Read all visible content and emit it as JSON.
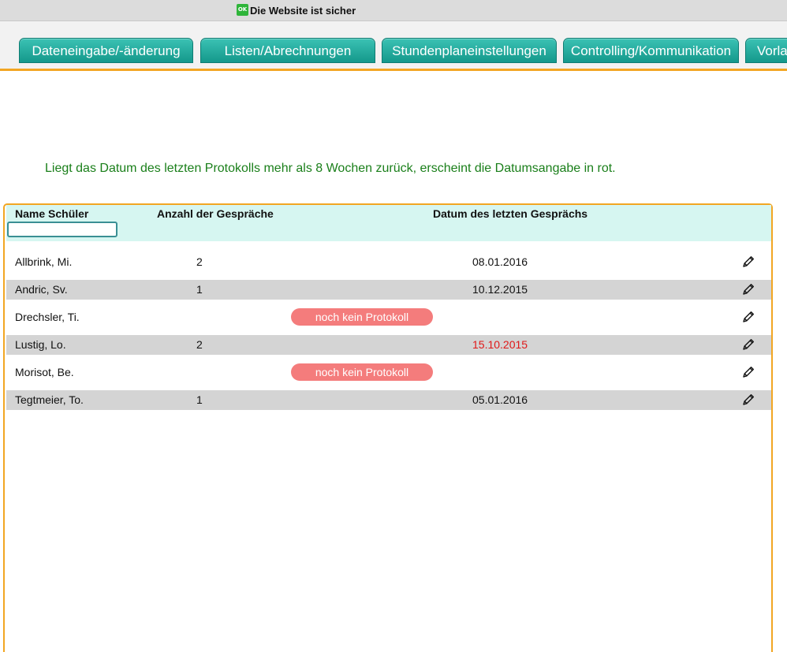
{
  "security": {
    "badge": "OK",
    "text": "Die Website ist sicher"
  },
  "tabs": [
    {
      "label": "Dateneingabe/-änderung"
    },
    {
      "label": "Listen/Abrechnungen"
    },
    {
      "label": "Stundenplaneinstellungen"
    },
    {
      "label": "Controlling/Kommunikation"
    },
    {
      "label": "Vorla"
    }
  ],
  "note": "Liegt das Datum des letzten Protokolls mehr als 8 Wochen zurück, erscheint die Datumsangabe in rot.",
  "table": {
    "headers": {
      "name": "Name Schüler",
      "count": "Anzahl der Gespräche",
      "date": "Datum des letzten Gesprächs"
    },
    "filter_value": "",
    "rows": [
      {
        "name": "Allbrink, Mi.",
        "count": "2",
        "date": "08.01.2016",
        "no_protocol": ""
      },
      {
        "name": "Andric, Sv.",
        "count": "1",
        "date": "10.12.2015",
        "no_protocol": ""
      },
      {
        "name": "Drechsler, Ti.",
        "count": "",
        "date": "",
        "no_protocol": "noch kein Protokoll"
      },
      {
        "name": "Lustig, Lo.",
        "count": "2",
        "date": "15.10.2015",
        "no_protocol": ""
      },
      {
        "name": "Morisot, Be.",
        "count": "",
        "date": "",
        "no_protocol": "noch kein Protokoll"
      },
      {
        "name": "Tegtmeier, To.",
        "count": "1",
        "date": "05.01.2016",
        "no_protocol": ""
      }
    ]
  },
  "colors": {
    "tab": "#1aa597",
    "accent_border": "#f2a623",
    "note_text": "#1a7f1a",
    "old_date": "#e01818",
    "pill": "#f47c7c",
    "header_bg": "#d6f6f1",
    "alt_row": "#d4d4d4"
  }
}
